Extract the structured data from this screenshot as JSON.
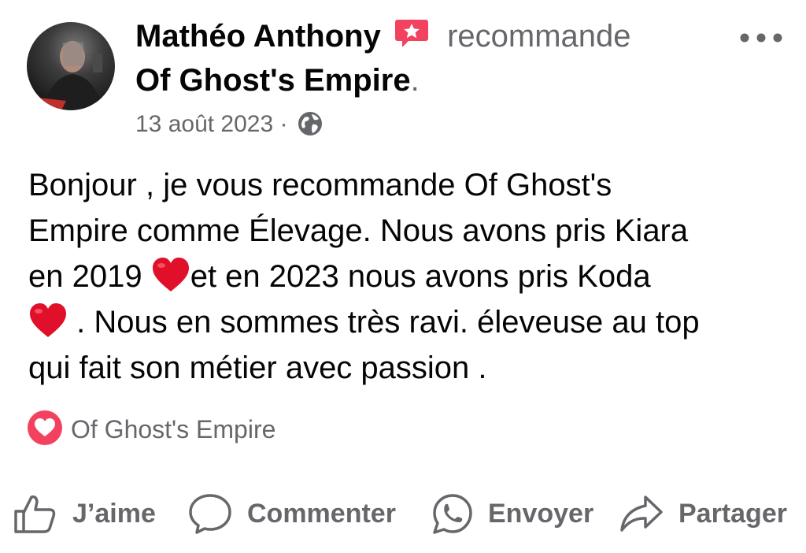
{
  "post": {
    "author_name": "Mathéo Anthony",
    "recommend_verb": "recommande",
    "page_name": "Of Ghost's Empire",
    "page_punct": ".",
    "date": "13 août 2023",
    "date_separator": "·",
    "privacy_icon": "globe-icon",
    "more_label": "•••",
    "text_lines": [
      "Bonjour , je vous recommande Of Ghost's",
      "Empire comme Élevage. Nous avons pris Kiara",
      "en 2019 ",
      "et en 2023 nous avons pris Koda",
      " . Nous en sommes très ravi. éleveuse au top",
      "qui fait son métier avec passion ."
    ],
    "tag_label": "Of Ghost's Empire"
  },
  "actions": {
    "like": "J’aime",
    "comment": "Commenter",
    "send": "Envoyer",
    "share": "Partager"
  },
  "colors": {
    "text_primary": "#050505",
    "text_secondary": "#65676b",
    "recommend_red": "#f3425f",
    "heart_red": "#e0102a"
  }
}
